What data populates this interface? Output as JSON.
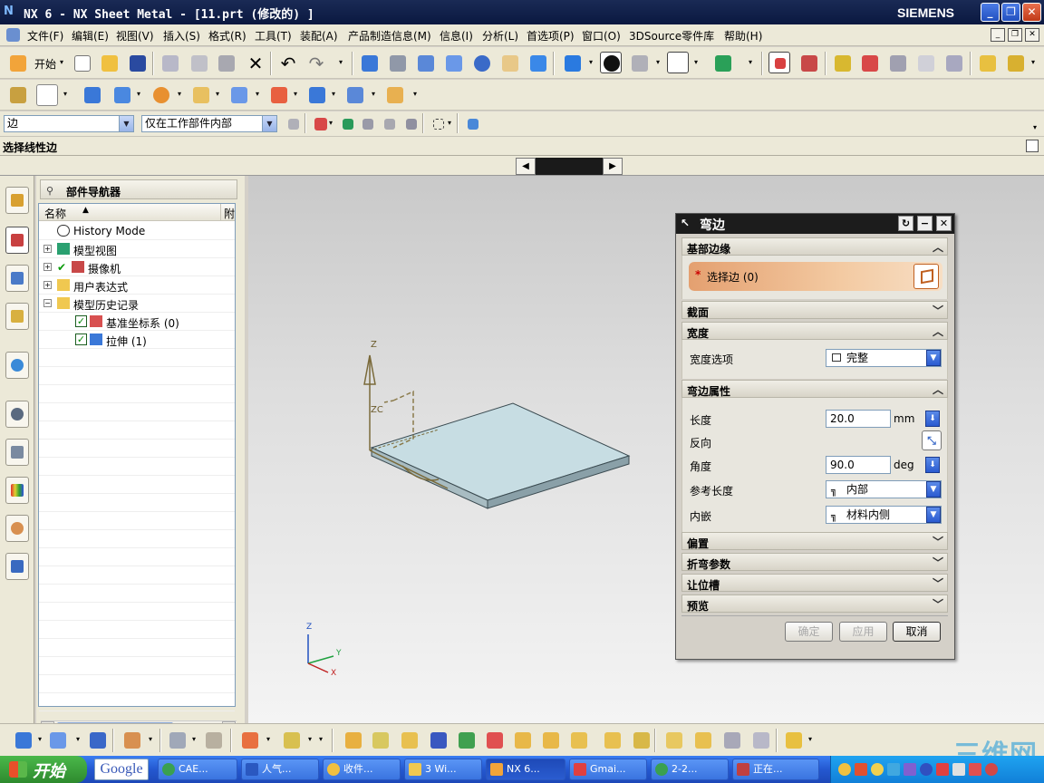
{
  "window": {
    "title": "NX 6 - NX Sheet Metal - [11.prt  (修改的) ]",
    "brand": "SIEMENS"
  },
  "menu": {
    "items": [
      "文件(F)",
      "编辑(E)",
      "视图(V)",
      "插入(S)",
      "格式(R)",
      "工具(T)",
      "装配(A)",
      "产品制造信息(M)",
      "信息(I)",
      "分析(L)",
      "首选项(P)",
      "窗口(O)",
      "3DSource零件库",
      "帮助(H)"
    ]
  },
  "toolbar": {
    "start_label": "开始",
    "filter_type": "边",
    "filter_scope": "仅在工作部件内部"
  },
  "cue": {
    "text": "选择线性边"
  },
  "navigator": {
    "title": "部件导航器",
    "col_name": "名称",
    "col_attach": "附",
    "tree": [
      {
        "label": "History Mode",
        "icon": "clock-icon"
      },
      {
        "label": "模型视图",
        "icon": "model-views-icon"
      },
      {
        "label": "摄像机",
        "icon": "camera-icon"
      },
      {
        "label": "用户表达式",
        "icon": "folder-icon"
      },
      {
        "label": "模型历史记录",
        "icon": "folder-icon"
      },
      {
        "label": "基准坐标系 (0)",
        "icon": "datum-csys-icon"
      },
      {
        "label": "拉伸 (1)",
        "icon": "extrude-icon"
      }
    ]
  },
  "viewport": {
    "triad_labels": {
      "z": "Z",
      "zc": "ZC"
    },
    "axis_labels": {
      "z": "Z",
      "y": "Y",
      "x": "X"
    }
  },
  "dialog": {
    "title": "弯边",
    "sections": {
      "base_edge": "基部边缘",
      "select_edge": "选择边 (0)",
      "section": "截面",
      "width": "宽度",
      "flange_props": "弯边属性",
      "offset": "偏置",
      "bend_params": "折弯参数",
      "relief": "让位槽",
      "preview": "预览"
    },
    "width_option_label": "宽度选项",
    "width_option_value": "完整",
    "length_label": "长度",
    "length_value": "20.0",
    "length_unit": "mm",
    "reverse_label": "反向",
    "angle_label": "角度",
    "angle_value": "90.0",
    "angle_unit": "deg",
    "ref_length_label": "参考长度",
    "ref_length_value": "内部",
    "inset_label": "内嵌",
    "inset_value": "材料内侧",
    "buttons": {
      "ok": "确定",
      "apply": "应用",
      "cancel": "取消"
    }
  },
  "taskbar": {
    "start": "开始",
    "google": "Google",
    "tasks": [
      "CAE...",
      "人气...",
      "收件...",
      "3 Wi...",
      "NX 6...",
      "Gmai...",
      "2-2...",
      "正在..."
    ],
    "active_index": 4
  },
  "watermark": {
    "text": "三维网"
  }
}
